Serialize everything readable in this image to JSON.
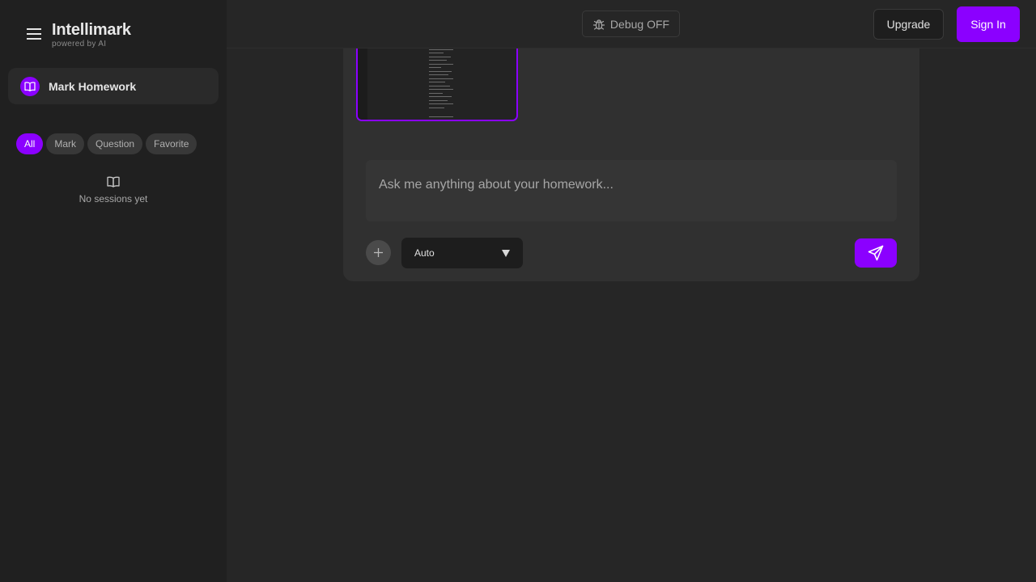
{
  "sidebar": {
    "brand_title": "Intellimark",
    "brand_subtitle": "powered by AI",
    "mark_homework_label": "Mark Homework",
    "filters": [
      "All",
      "Mark",
      "Question",
      "Favorite"
    ],
    "active_filter": "All",
    "empty_text": "No sessions yet",
    "icons": {
      "menu": "hamburger-menu-icon",
      "mark": "open-book-icon",
      "empty": "open-book-icon"
    }
  },
  "header": {
    "debug_label": "Debug OFF",
    "upgrade_label": "Upgrade",
    "signin_label": "Sign In",
    "icons": {
      "debug": "bug-icon"
    }
  },
  "composer": {
    "prompt_placeholder": "Ask me anything about your homework...",
    "model_value": "Auto",
    "icons": {
      "add": "plus-icon",
      "dropdown": "caret-down-icon",
      "send": "send-icon"
    }
  },
  "colors": {
    "accent": "#8b00ff",
    "background": "#262626",
    "sidebar": "#202020",
    "panel": "#303030"
  }
}
